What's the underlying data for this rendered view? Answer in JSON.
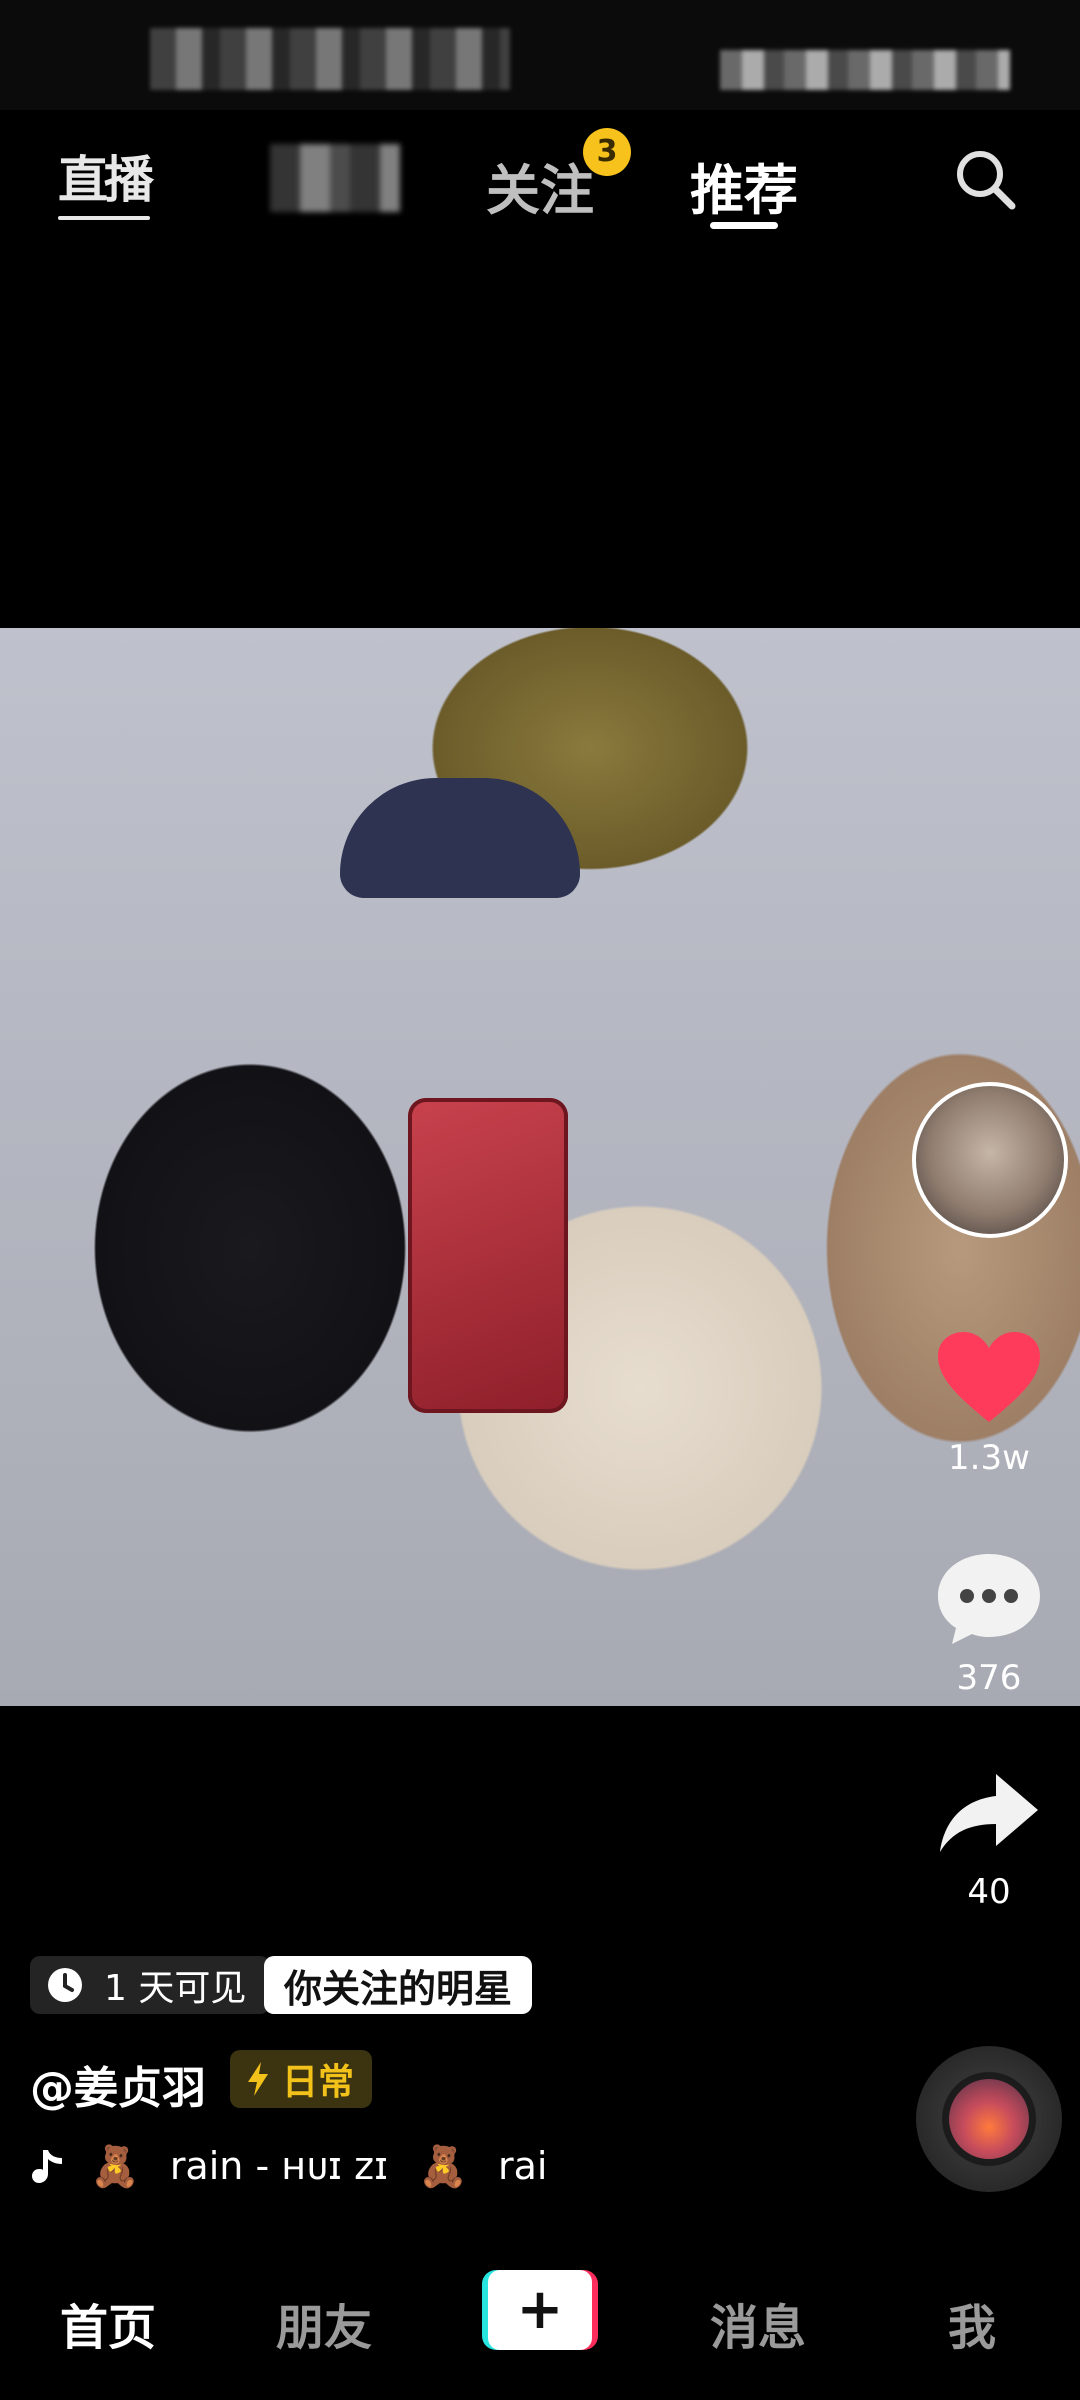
{
  "top_nav": {
    "live_label": "直播",
    "follow_label": "关注",
    "follow_badge": "3",
    "recommend_label": "推荐"
  },
  "video": {
    "likes": "1.3w",
    "comments": "376",
    "shares": "40"
  },
  "post": {
    "visibility": "1 天可见",
    "relation_tag": "你关注的明星",
    "author": "@姜贞羽",
    "category_tag": "日常",
    "music": {
      "bear1": "🧸",
      "title": "rain - ʜᴜɪ ᴢɪ",
      "bear2": "🧸",
      "trailing": "rai"
    }
  },
  "bottom_nav": {
    "home": "首页",
    "friends": "朋友",
    "create": "+",
    "messages": "消息",
    "me": "我"
  },
  "colors": {
    "accent_yellow": "#f6c21b",
    "like_red": "#ff3b5c",
    "create_cyan": "#29e5e0",
    "create_pink": "#ff2d5c"
  },
  "icons": {
    "search": "search-icon",
    "like": "heart-icon",
    "comment": "comment-bubble-icon",
    "share": "share-arrow-icon",
    "clock": "clock-icon",
    "bolt": "lightning-icon",
    "music": "music-note-icon"
  }
}
